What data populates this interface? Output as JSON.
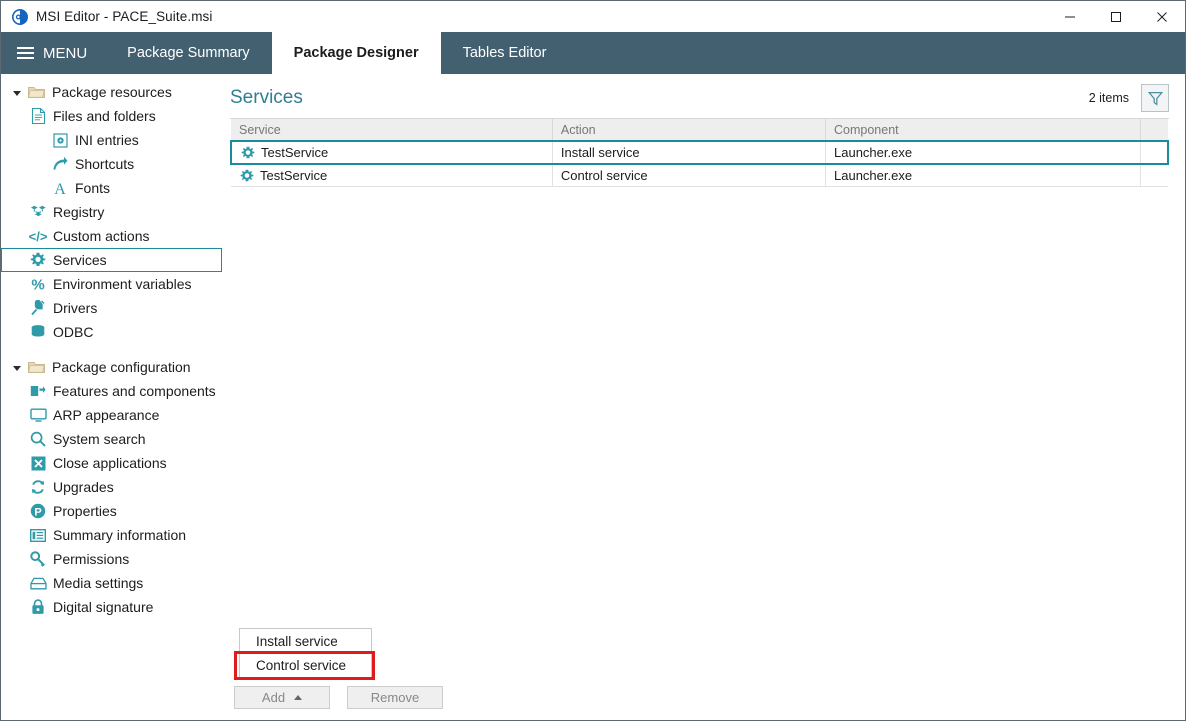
{
  "window": {
    "title": "MSI Editor - PACE_Suite.msi",
    "app_icon": "pace-suite-logo-icon",
    "controls": [
      {
        "name": "minimize-button",
        "icon": "minimize-icon",
        "glyph": "—"
      },
      {
        "name": "maximize-button",
        "icon": "maximize-icon",
        "glyph": "□"
      },
      {
        "name": "close-button",
        "icon": "close-icon",
        "glyph": "✕"
      }
    ]
  },
  "menubar": {
    "menu_label": "MENU",
    "menu_icon": "hamburger-icon",
    "tabs": [
      {
        "label": "Package Summary",
        "active": false
      },
      {
        "label": "Package Designer",
        "active": true
      },
      {
        "label": "Tables Editor",
        "active": false
      }
    ],
    "background_color": "#426070"
  },
  "sidebar": {
    "groups": [
      {
        "label": "Package resources",
        "icon": "folder-icon",
        "expanded": true,
        "items": [
          {
            "label": "Files and folders",
            "icon": "document-icon",
            "indent": 1,
            "selected": false
          },
          {
            "label": "INI entries",
            "icon": "ini-file-icon",
            "indent": 2,
            "selected": false
          },
          {
            "label": "Shortcuts",
            "icon": "shortcut-arrow-icon",
            "indent": 2,
            "selected": false
          },
          {
            "label": "Fonts",
            "icon": "font-letter-a-icon",
            "indent": 2,
            "selected": false
          },
          {
            "label": "Registry",
            "icon": "registry-blocks-icon",
            "indent": 1,
            "selected": false
          },
          {
            "label": "Custom actions",
            "icon": "code-brackets-icon",
            "indent": 1,
            "selected": false
          },
          {
            "label": "Services",
            "icon": "gear-icon",
            "indent": 1,
            "selected": true
          },
          {
            "label": "Environment variables",
            "icon": "percent-icon",
            "indent": 1,
            "selected": false
          },
          {
            "label": "Drivers",
            "icon": "plug-icon",
            "indent": 1,
            "selected": false
          },
          {
            "label": "ODBC",
            "icon": "database-icon",
            "indent": 1,
            "selected": false
          }
        ]
      },
      {
        "label": "Package configuration",
        "icon": "folder-icon",
        "expanded": true,
        "items": [
          {
            "label": "Features and components",
            "icon": "features-icon",
            "indent": 1,
            "selected": false
          },
          {
            "label": "ARP appearance",
            "icon": "monitor-icon",
            "indent": 1,
            "selected": false
          },
          {
            "label": "System search",
            "icon": "search-icon",
            "indent": 1,
            "selected": false
          },
          {
            "label": "Close applications",
            "icon": "x-square-icon",
            "indent": 1,
            "selected": false
          },
          {
            "label": "Upgrades",
            "icon": "refresh-icon",
            "indent": 1,
            "selected": false
          },
          {
            "label": "Properties",
            "icon": "letter-p-circle-icon",
            "indent": 1,
            "selected": false
          },
          {
            "label": "Summary information",
            "icon": "list-panel-icon",
            "indent": 1,
            "selected": false
          },
          {
            "label": "Permissions",
            "icon": "key-icon",
            "indent": 1,
            "selected": false
          },
          {
            "label": "Media settings",
            "icon": "media-drive-icon",
            "indent": 1,
            "selected": false
          },
          {
            "label": "Digital signature",
            "icon": "lock-icon",
            "indent": 1,
            "selected": false
          }
        ]
      }
    ],
    "accent_color": "#1d8a9c"
  },
  "content": {
    "page_title": "Services",
    "item_count": "2 items",
    "filter_icon": "filter-funnel-icon",
    "table": {
      "columns": [
        "Service",
        "Action",
        "Component",
        ""
      ],
      "rows": [
        {
          "icon": "gear-icon",
          "service": "TestService",
          "action": "Install service",
          "component": "Launcher.exe",
          "extra": "",
          "selected": true
        },
        {
          "icon": "gear-icon",
          "service": "TestService",
          "action": "Control service",
          "component": "Launcher.exe",
          "extra": "",
          "selected": false
        }
      ]
    }
  },
  "footer": {
    "add_button": "Add",
    "add_caret_icon": "caret-up-icon",
    "remove_button": "Remove"
  },
  "dropdown": {
    "items": [
      {
        "label": "Install service",
        "highlighted": false
      },
      {
        "label": "Control service",
        "highlighted": true
      }
    ],
    "highlight_color": "#e01b1b"
  }
}
